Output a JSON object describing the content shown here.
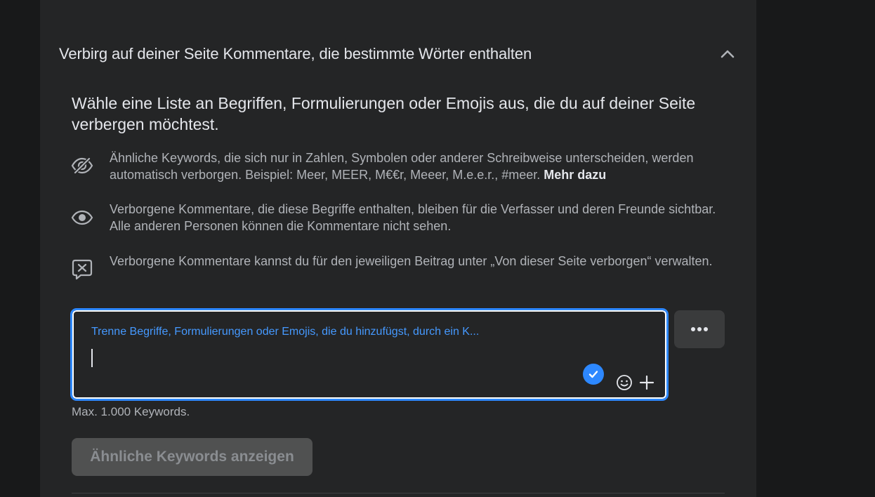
{
  "section": {
    "title": "Verbirg auf deiner Seite Kommentare, die bestimmte Wörter enthalten",
    "chevron_icon": "chevron-up-icon"
  },
  "intro": {
    "text": "Wähle eine Liste an Begriffen, Formulierungen oder Emojis aus, die du auf deiner Seite verbergen möchtest."
  },
  "info_rows": [
    {
      "icon": "eye-slash-icon",
      "text": "Ähnliche Keywords, die sich nur in Zahlen, Symbolen oder anderer Schreibweise unterscheiden, werden automatisch verborgen. Beispiel: Meer, MEER, M€€r, Meeer, M.e.e.r., #meer.",
      "link": "Mehr dazu"
    },
    {
      "icon": "eye-icon",
      "text": "Verborgene Kommentare, die diese Begriffe enthalten, bleiben für die Verfasser und deren Freunde sichtbar. Alle anderen Personen können die Kommentare nicht sehen."
    },
    {
      "icon": "comment-x-icon",
      "text": "Verborgene Kommentare kannst du für den jeweiligen Beitrag unter „Von dieser Seite verborgen“ verwalten."
    }
  ],
  "keyword_input": {
    "placeholder": "Trenne Begriffe, Formulierungen oder Emojis, die du hinzufügst, durch ein K...",
    "value": "",
    "check_icon": "check-circle-icon",
    "emoji_icon": "smiley-icon",
    "plus_icon": "plus-icon"
  },
  "more_button": {
    "icon": "more-dots-icon"
  },
  "max_note": "Max. 1.000 Keywords.",
  "similar_button": {
    "label": "Ähnliche Keywords anzeigen"
  },
  "colors": {
    "accent": "#2d88ff",
    "panel_bg": "#242526",
    "page_bg": "#18191a"
  }
}
